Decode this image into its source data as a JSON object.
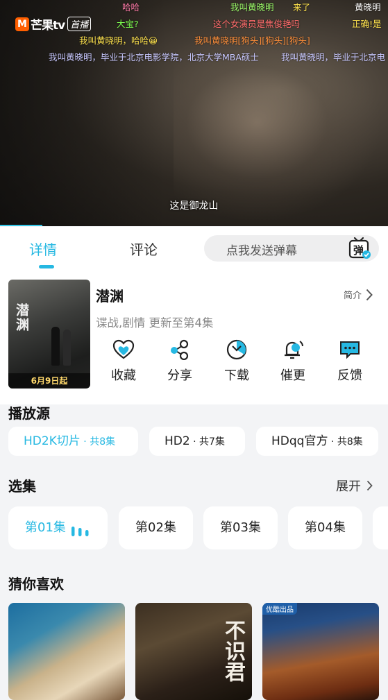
{
  "player": {
    "logo": {
      "mark": "M",
      "brand": "芒果tv",
      "tag": "首播"
    },
    "subtitle": "这是御龙山",
    "danmaku": [
      {
        "text": "哈哈",
        "color": "#ff7aa8"
      },
      {
        "text": "我叫黄晓明",
        "color": "#9dff6a"
      },
      {
        "text": "来了",
        "color": "#ffe34d"
      },
      {
        "text": "黄晓明",
        "color": "#ffffff"
      },
      {
        "text": "大宝?",
        "color": "#7dff4f"
      },
      {
        "text": "这个女演员是焦俊艳吗",
        "color": "#ff6b6b"
      },
      {
        "text": "正确!是",
        "color": "#ffe34d"
      },
      {
        "text": "我叫黄晓明，哈哈😀",
        "color": "#ffe34d"
      },
      {
        "text": "我叫黄晓明[狗头][狗头][狗头]",
        "color": "#ff8f3a"
      },
      {
        "text": "我叫黄晓明，毕业于北京电影学院，北京大学MBA硕士",
        "color": "#c8c8ff"
      },
      {
        "text": "我叫黄晓明，毕业于北京电",
        "color": "#c8c8ff"
      }
    ],
    "progress_percent": 11
  },
  "tabs": {
    "detail": "详情",
    "comment": "评论",
    "danmu_placeholder": "点我发送弹幕",
    "danmu_toggle_label": "弹"
  },
  "show": {
    "title": "潜渊",
    "intro_label": "简介",
    "meta": "谍战,剧情 更新至第4集",
    "poster_title": "潜渊",
    "poster_date": "6月9日起"
  },
  "actions": [
    {
      "label": "收藏",
      "icon": "heart-icon"
    },
    {
      "label": "分享",
      "icon": "share-icon"
    },
    {
      "label": "下载",
      "icon": "download-icon"
    },
    {
      "label": "催更",
      "icon": "bell-icon"
    },
    {
      "label": "反馈",
      "icon": "feedback-icon"
    }
  ],
  "sources": {
    "title": "播放源",
    "items": [
      {
        "name": "HD2K切片",
        "count": " · 共8集"
      },
      {
        "name": "HD2",
        "count": " · 共7集"
      },
      {
        "name": "HDqq官方",
        "count": " · 共8集"
      }
    ],
    "active_index": 0
  },
  "episodes": {
    "title": "选集",
    "more_label": "展开",
    "items": [
      "第01集",
      "第02集",
      "第03集",
      "第04集"
    ],
    "active_index": 0
  },
  "recommend": {
    "title": "猜你喜欢",
    "items": [
      {
        "calligraphy": ""
      },
      {
        "calligraphy": "不识君"
      },
      {
        "badge": "优酷出品"
      }
    ]
  },
  "colors": {
    "accent": "#26b8e2",
    "background": "#f3f4f6"
  }
}
